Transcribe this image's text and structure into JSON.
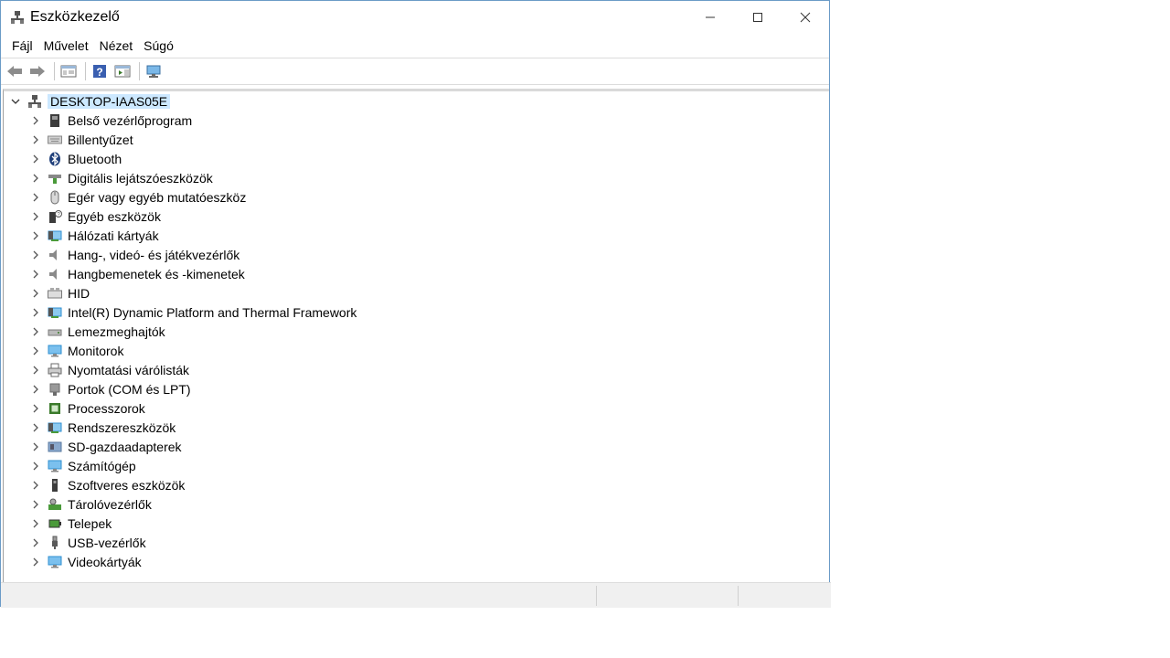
{
  "window": {
    "title": "Eszközkezelő"
  },
  "menu": [
    "Fájl",
    "Művelet",
    "Nézet",
    "Súgó"
  ],
  "tree": {
    "root": "DESKTOP-IAAS05E",
    "children": [
      {
        "label": "Belső vezérlőprogram",
        "icon": "firmware-icon",
        "color": "#3c3c3c"
      },
      {
        "label": "Billentyűzet",
        "icon": "keyboard-icon",
        "color": "#8a8a8a"
      },
      {
        "label": "Bluetooth",
        "icon": "bluetooth-icon",
        "color": "#1f3f7a"
      },
      {
        "label": "Digitális lejátszóeszközök",
        "icon": "digital-player-icon",
        "color": "#4a9a3a"
      },
      {
        "label": "Egér vagy egyéb mutatóeszköz",
        "icon": "mouse-icon",
        "color": "#6a6a6a"
      },
      {
        "label": "Egyéb eszközök",
        "icon": "other-devices-icon",
        "color": "#3c3c3c"
      },
      {
        "label": "Hálózati kártyák",
        "icon": "network-adapter-icon",
        "color": "#2f8fd0"
      },
      {
        "label": "Hang-, videó- és játékvezérlők",
        "icon": "speaker-icon",
        "color": "#8a8a8a"
      },
      {
        "label": "Hangbemenetek és -kimenetek",
        "icon": "audio-io-icon",
        "color": "#8a8a8a"
      },
      {
        "label": "HID",
        "icon": "hid-icon",
        "color": "#7a7a7a"
      },
      {
        "label": "Intel(R) Dynamic Platform and Thermal Framework",
        "icon": "system-device-icon",
        "color": "#2f8fd0"
      },
      {
        "label": "Lemezmeghajtók",
        "icon": "disk-drive-icon",
        "color": "#7a7a7a"
      },
      {
        "label": "Monitorok",
        "icon": "monitor-icon",
        "color": "#2f8fd0"
      },
      {
        "label": "Nyomtatási várólisták",
        "icon": "printer-icon",
        "color": "#6a6a6a"
      },
      {
        "label": "Portok (COM és LPT)",
        "icon": "port-icon",
        "color": "#6a6a6a"
      },
      {
        "label": "Processzorok",
        "icon": "processor-icon",
        "color": "#3a7a2a"
      },
      {
        "label": "Rendszereszközök",
        "icon": "system-device-icon",
        "color": "#2f8fd0"
      },
      {
        "label": "SD-gazdaadapterek",
        "icon": "sd-host-icon",
        "color": "#5a7aa0"
      },
      {
        "label": "Számítógép",
        "icon": "computer-icon",
        "color": "#2f8fd0"
      },
      {
        "label": "Szoftveres eszközök",
        "icon": "software-device-icon",
        "color": "#3c3c3c"
      },
      {
        "label": "Tárolóvezérlők",
        "icon": "storage-controller-icon",
        "color": "#4a9a3a"
      },
      {
        "label": "Telepek",
        "icon": "battery-icon",
        "color": "#4a9a3a"
      },
      {
        "label": "USB-vezérlők",
        "icon": "usb-icon",
        "color": "#5a5a5a"
      },
      {
        "label": "Videokártyák",
        "icon": "display-adapter-icon",
        "color": "#2f8fd0"
      }
    ]
  }
}
